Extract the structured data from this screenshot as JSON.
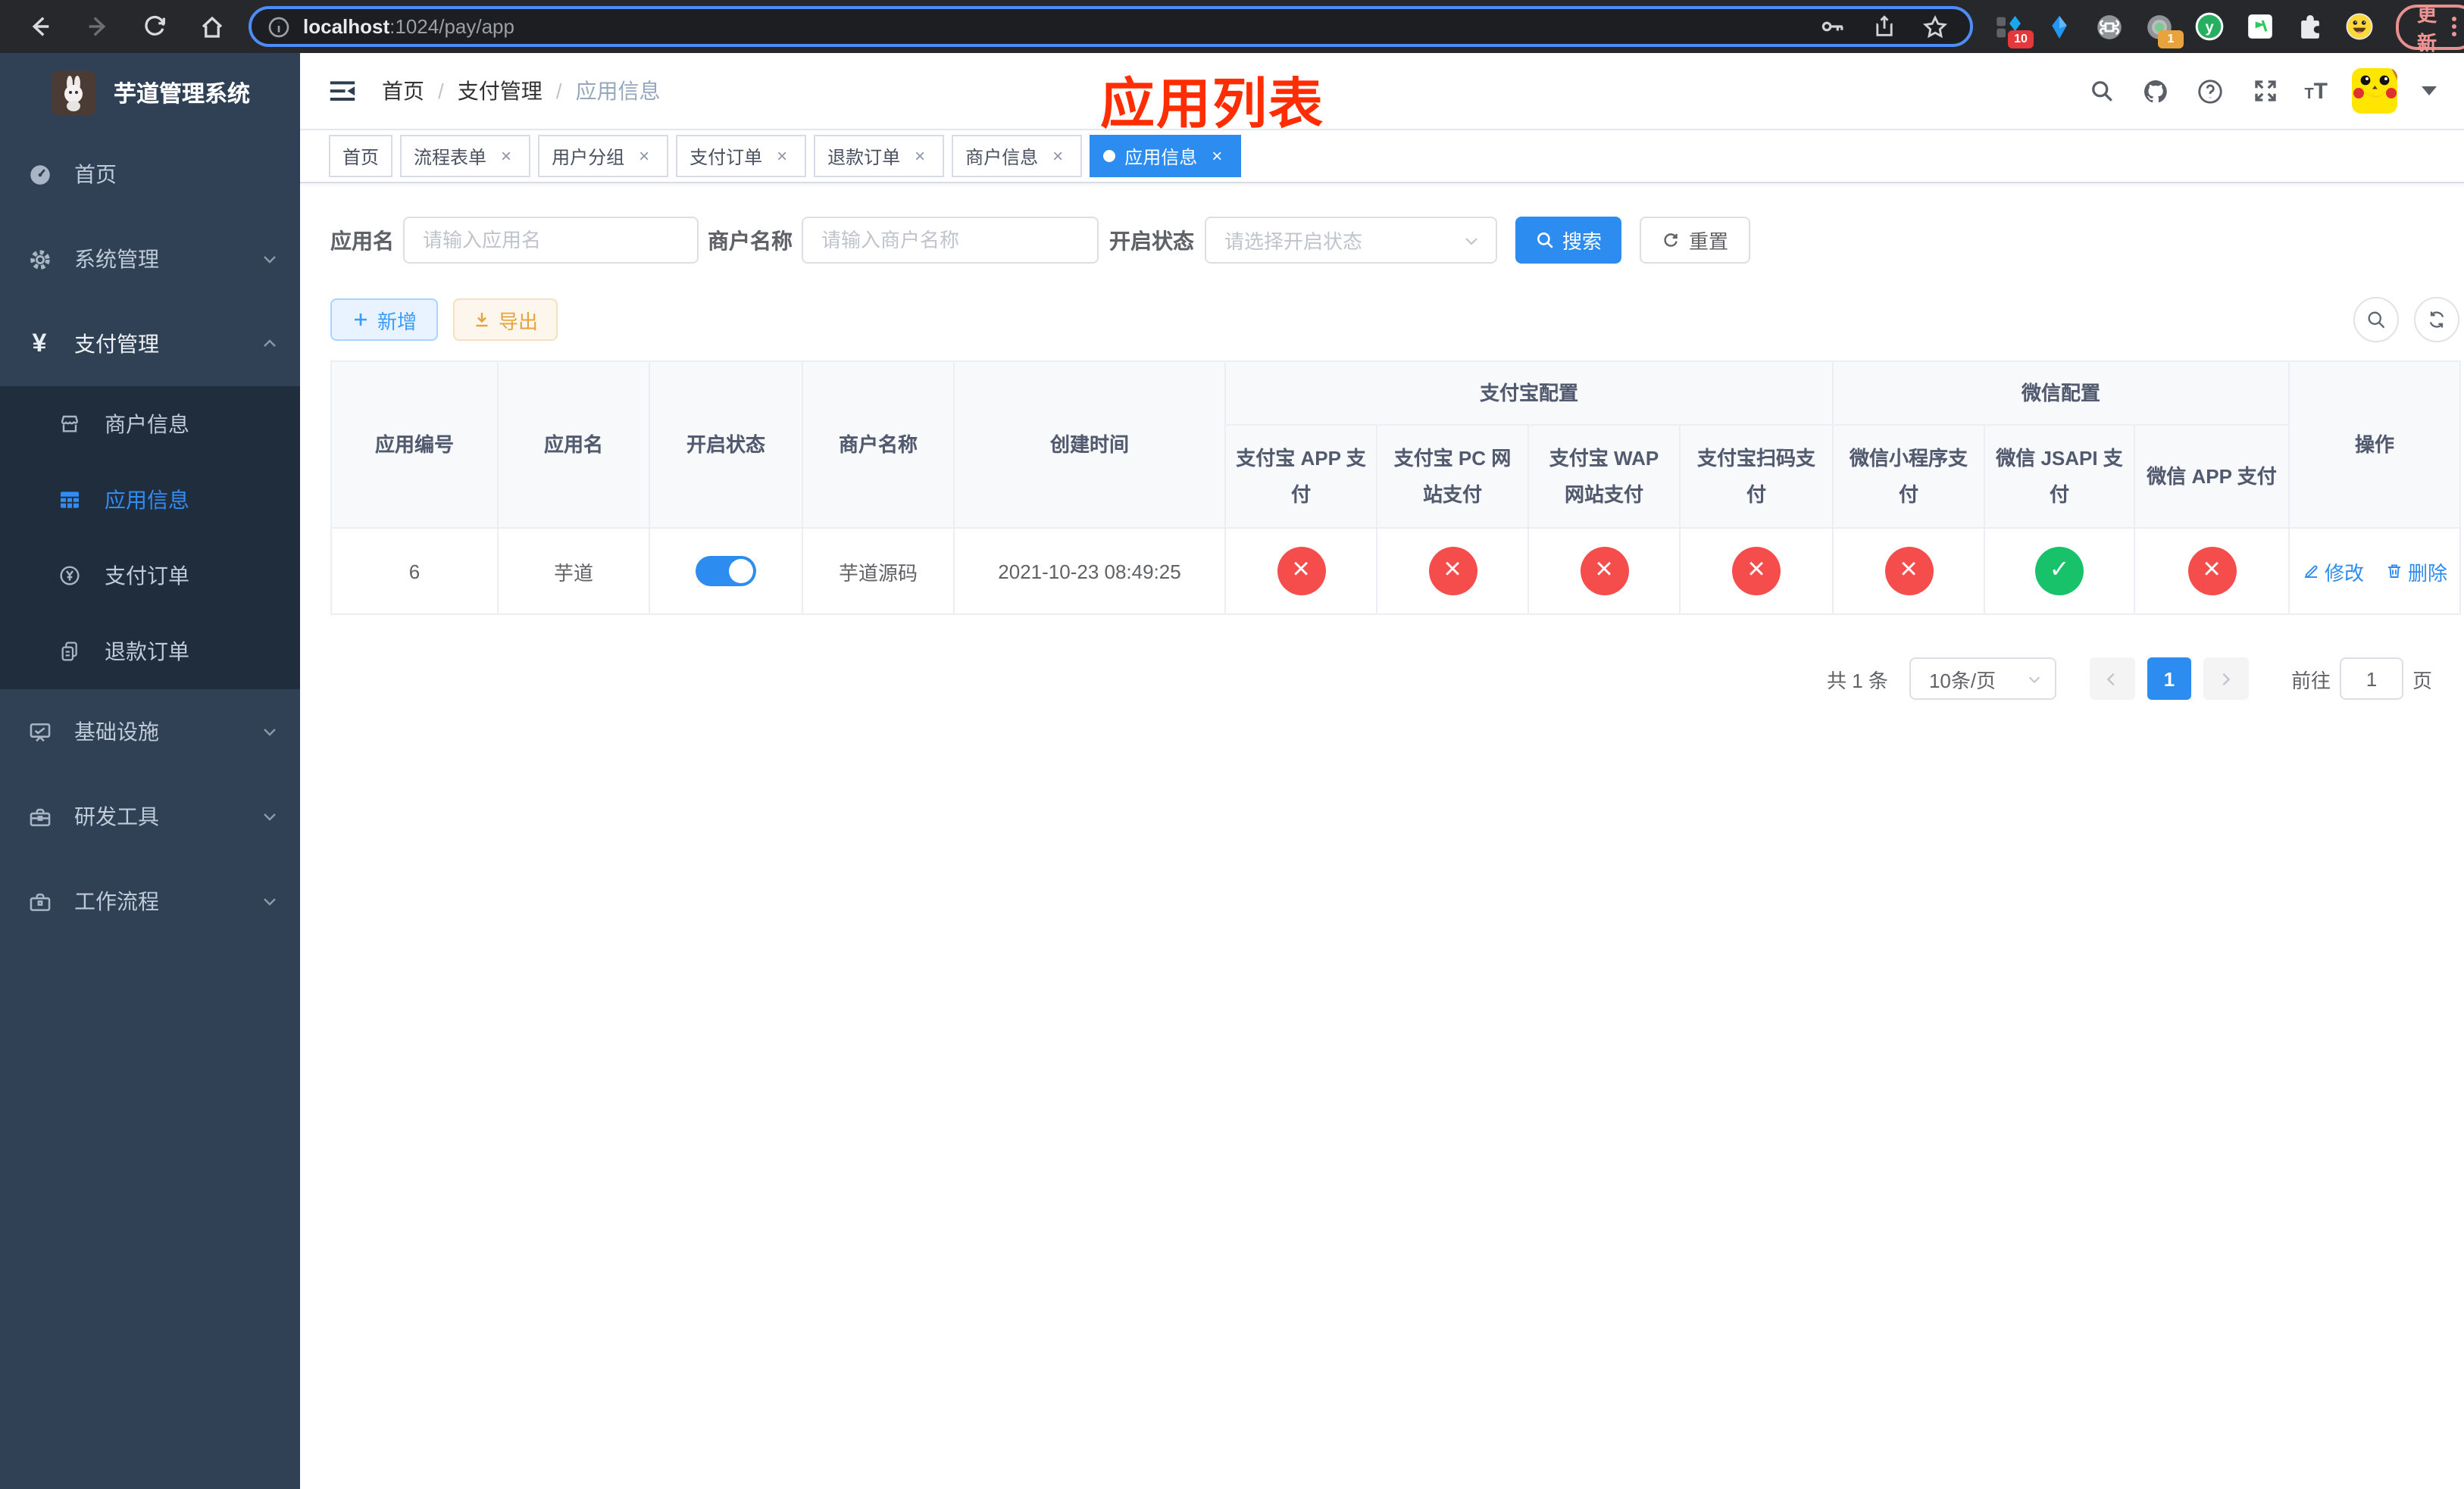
{
  "browser": {
    "url_host": "localhost",
    "url_rest": ":1024/pay/app",
    "ext_badge_tabs": "10",
    "ext_badge_proxy": "1",
    "update_label": "更新"
  },
  "sidebar": {
    "title": "芋道管理系统",
    "items": [
      {
        "label": "首页"
      },
      {
        "label": "系统管理",
        "expanded": false
      },
      {
        "label": "支付管理",
        "expanded": true
      },
      {
        "label": "商户信息"
      },
      {
        "label": "应用信息",
        "active": true
      },
      {
        "label": "支付订单"
      },
      {
        "label": "退款订单"
      },
      {
        "label": "基础设施",
        "expanded": false
      },
      {
        "label": "研发工具",
        "expanded": false
      },
      {
        "label": "工作流程",
        "expanded": false
      }
    ]
  },
  "navbar": {
    "breadcrumb": [
      "首页",
      "支付管理",
      "应用信息"
    ],
    "annotation": "应用列表"
  },
  "tabs": [
    {
      "label": "首页",
      "closable": false,
      "active": false
    },
    {
      "label": "流程表单",
      "closable": true,
      "active": false
    },
    {
      "label": "用户分组",
      "closable": true,
      "active": false
    },
    {
      "label": "支付订单",
      "closable": true,
      "active": false
    },
    {
      "label": "退款订单",
      "closable": true,
      "active": false
    },
    {
      "label": "商户信息",
      "closable": true,
      "active": false
    },
    {
      "label": "应用信息",
      "closable": true,
      "active": true
    }
  ],
  "filters": {
    "app_name_label": "应用名",
    "app_name_placeholder": "请输入应用名",
    "merchant_label": "商户名称",
    "merchant_placeholder": "请输入商户名称",
    "status_label": "开启状态",
    "status_placeholder": "请选择开启状态",
    "search_label": "搜索",
    "reset_label": "重置"
  },
  "toolbar": {
    "add_label": "新增",
    "export_label": "导出"
  },
  "table": {
    "columns": [
      "应用编号",
      "应用名",
      "开启状态",
      "商户名称",
      "创建时间"
    ],
    "group_alipay": "支付宝配置",
    "group_wechat": "微信配置",
    "op_column": "操作",
    "sub_columns": [
      "支付宝 APP 支付",
      "支付宝 PC 网站支付",
      "支付宝 WAP 网站支付",
      "支付宝扫码支付",
      "微信小程序支付",
      "微信 JSAPI 支付",
      "微信 APP 支付"
    ],
    "row": {
      "id": "6",
      "name": "芋道",
      "enabled": "on",
      "merchant": "芋道源码",
      "created_at": "2021-10-23 08:49:25",
      "statuses": [
        "disabled",
        "disabled",
        "disabled",
        "disabled",
        "disabled",
        "enabled",
        "disabled"
      ],
      "edit_label": "修改",
      "delete_label": "删除"
    }
  },
  "pagination": {
    "total": "共 1 条",
    "page_size": "10条/页",
    "page": "1",
    "goto_label": "前往",
    "goto_value": "1",
    "page_suffix": "页"
  },
  "colors": {
    "primary": "#2d8cf0",
    "success": "#17c26b",
    "danger": "#f54c4c",
    "warning": "#e6a23c",
    "sidebar_bg": "#304156",
    "submenu_bg": "#1f2d3d",
    "annotation_red": "#ff2d00"
  }
}
